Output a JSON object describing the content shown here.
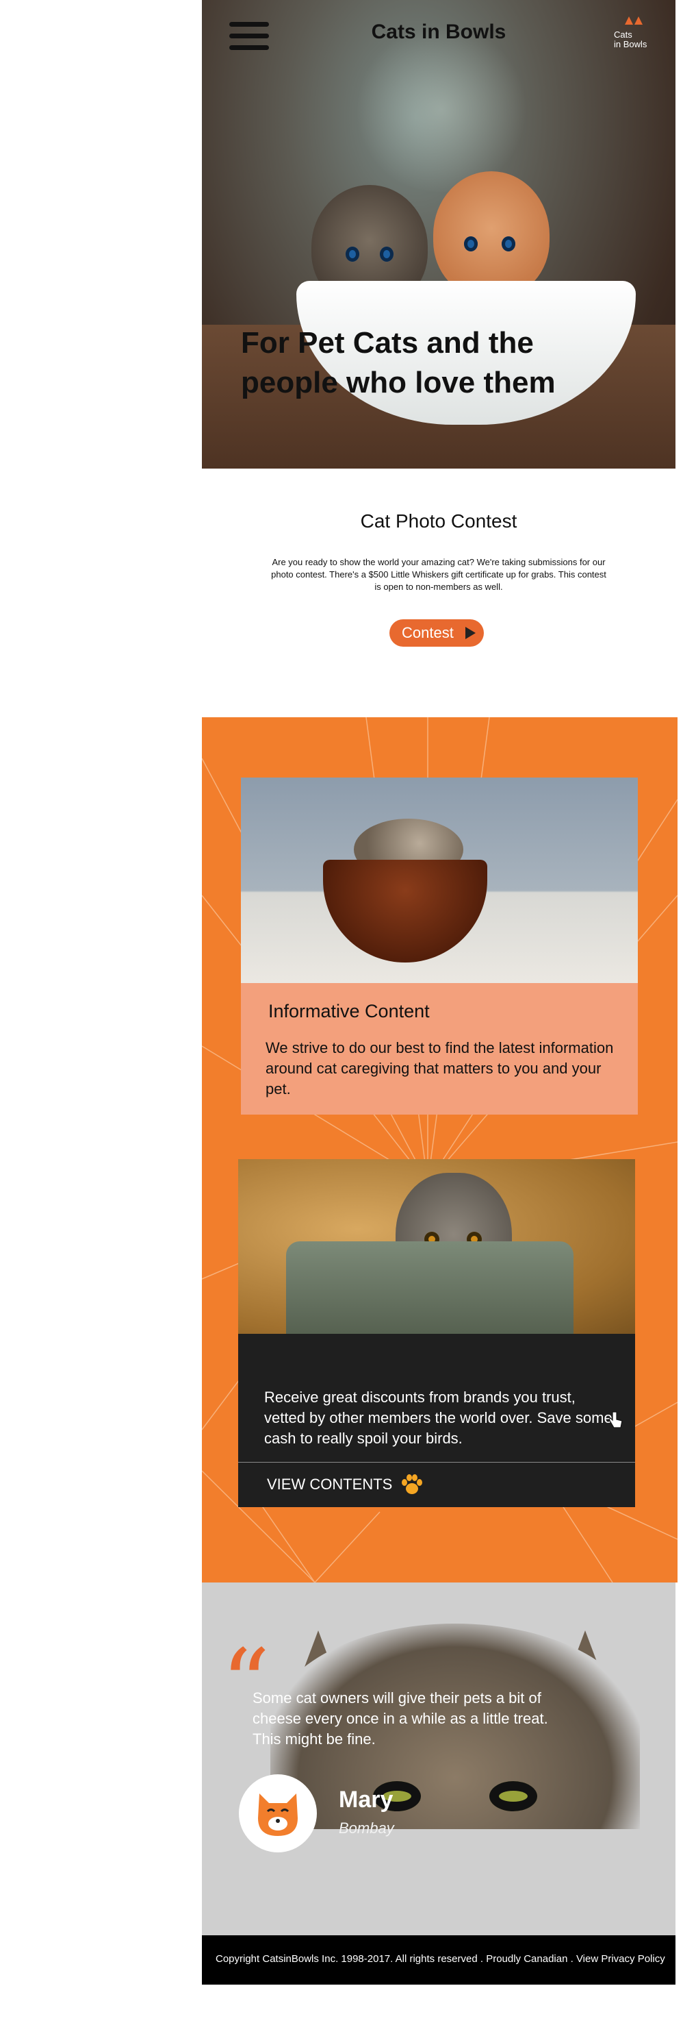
{
  "header": {
    "title": "Cats in Bowls",
    "logo_text_line1": "Cats",
    "logo_text_line2": "in Bowls",
    "menu_icon": "hamburger-icon"
  },
  "hero": {
    "headline": "For Pet Cats and the people who love them"
  },
  "contest": {
    "title": "Cat Photo Contest",
    "description": "Are you ready to show the world your amazing cat? We're taking submissions for our photo contest. There's a $500 Little Whiskers gift certificate up for grabs. This contest is open to non-members as well.",
    "button_label": "Contest",
    "button_icon": "play-icon"
  },
  "cards": [
    {
      "title": "Informative Content",
      "text": "We strive to do our best to find the latest information around cat caregiving that matters to you and your pet."
    },
    {
      "text": "Receive great discounts from brands you trust, vetted by other members the world over. Save some cash to really spoil your birds.",
      "link_label": "VIEW CONTENTS",
      "link_icon": "paw-icon"
    }
  ],
  "testimonial": {
    "quote": "Some cat owners will give their pets a bit of cheese every once in a while as a little treat. This might be fine.",
    "name": "Mary",
    "breed": "Bombay"
  },
  "footer": {
    "text": "Copyright CatsinBowls Inc. 1998-2017. All rights reserved . Proudly Canadian . View Privacy Policy"
  },
  "colors": {
    "accent": "#e8692f",
    "orange_section": "#f27e2c",
    "card_light": "#f3a07c",
    "card_dark": "#1f1f1f"
  }
}
